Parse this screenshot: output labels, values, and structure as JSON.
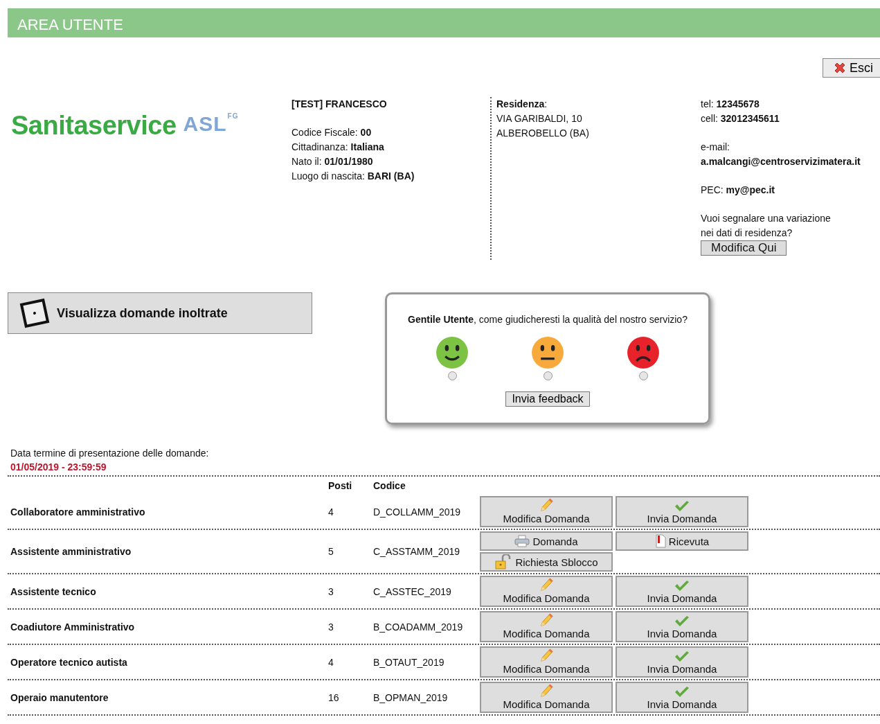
{
  "header": {
    "title": "AREA UTENTE"
  },
  "logout_button": {
    "label": "Esci"
  },
  "logo": {
    "name": "Sanitaservice",
    "mark": "ASL",
    "superscript": "FG"
  },
  "person": {
    "name": "[TEST] FRANCESCO",
    "fields": [
      {
        "label": "Codice Fiscale: ",
        "value": "00"
      },
      {
        "label": "Cittadinanza: ",
        "value": "Italiana"
      },
      {
        "label": "Nato il: ",
        "value": "01/01/1980"
      },
      {
        "label": "Luogo di nascita: ",
        "value": "BARI (BA)"
      }
    ]
  },
  "residence": {
    "heading": "**Residenza**:",
    "lines": [
      "VIA GARIBALDI, 10",
      "ALBEROBELLO (BA)"
    ]
  },
  "contacts": {
    "phone": "tel: **12345678**",
    "mobile": "cell: **32012345611**",
    "email_label": "e-mail:",
    "email": "a.malcangi@centroservizimatera.it",
    "pec": "PEC: **my@pec.it**",
    "change_prompt": "Vuoi segnalare una variazione nei dati di residenza?",
    "change_button": "Modifica Qui"
  },
  "view_button": {
    "label": "Visualizza domande inoltrate"
  },
  "feedback": {
    "question": "**Gentile Utente**, come giudicheresti la qualità del nostro servizio?",
    "options": [
      {
        "kind": "happy",
        "color": "#7cc243",
        "selected": false
      },
      {
        "kind": "neutral",
        "color": "#f7a93b",
        "selected": false
      },
      {
        "kind": "sad",
        "color": "#e8222a",
        "selected": false
      }
    ],
    "button": "Invia feedback"
  },
  "deadline": {
    "label": "Data termine di presentazione delle domande:",
    "value": "01/05/2019 - 23:59:59"
  },
  "table": {
    "columns": [
      "Posti",
      "Codice"
    ],
    "rows": [
      {
        "name": "Collaboratore amministrativo",
        "posti": "4",
        "codice": "D_COLLAMM_2019",
        "actions": [
          {
            "kind": "edit",
            "label": "Modifica Domanda"
          },
          {
            "kind": "send",
            "label": "Invia Domanda"
          }
        ]
      },
      {
        "name": "Assistente amministrativo",
        "posti": "5",
        "codice": "C_ASSTAMM_2019",
        "actions": [
          {
            "kind": "print",
            "label": "Domanda"
          },
          {
            "kind": "receipt",
            "label": "Ricevuta"
          },
          {
            "kind": "unlock",
            "label": "Richiesta Sblocco"
          }
        ]
      },
      {
        "name": "Assistente tecnico",
        "posti": "3",
        "codice": "C_ASSTEC_2019",
        "actions": [
          {
            "kind": "edit",
            "label": "Modifica Domanda"
          },
          {
            "kind": "send",
            "label": "Invia Domanda"
          }
        ]
      },
      {
        "name": "Coadiutore Amministrativo",
        "posti": "3",
        "codice": "B_COADAMM_2019",
        "actions": [
          {
            "kind": "edit",
            "label": "Modifica Domanda"
          },
          {
            "kind": "send",
            "label": "Invia Domanda"
          }
        ]
      },
      {
        "name": "Operatore tecnico autista",
        "posti": "4",
        "codice": "B_OTAUT_2019",
        "actions": [
          {
            "kind": "edit",
            "label": "Modifica Domanda"
          },
          {
            "kind": "send",
            "label": "Invia Domanda"
          }
        ]
      },
      {
        "name": "Operaio manutentore",
        "posti": "16",
        "codice": "B_OPMAN_2019",
        "actions": [
          {
            "kind": "edit",
            "label": "Modifica Domanda"
          },
          {
            "kind": "send",
            "label": "Invia Domanda"
          }
        ]
      }
    ]
  }
}
